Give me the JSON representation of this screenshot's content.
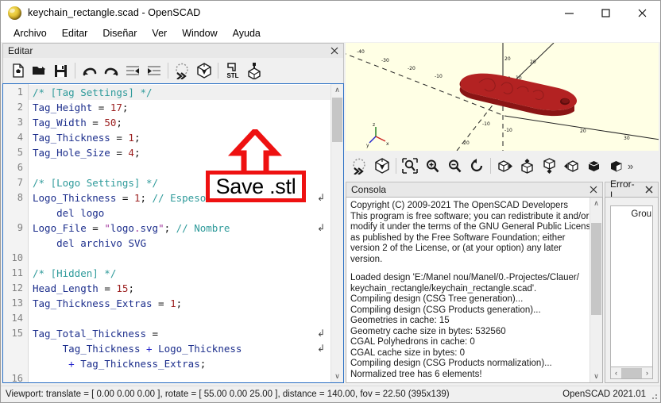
{
  "window": {
    "title": "keychain_rectangle.scad - OpenSCAD",
    "icon": "openscad-logo-icon",
    "minimize_label": "—",
    "maximize_label": "□",
    "close_label": "✕"
  },
  "menubar": {
    "items": [
      {
        "label": "Archivo",
        "name": "menu-archivo"
      },
      {
        "label": "Editar",
        "name": "menu-editar"
      },
      {
        "label": "Diseñar",
        "name": "menu-disenar"
      },
      {
        "label": "Ver",
        "name": "menu-ver"
      },
      {
        "label": "Window",
        "name": "menu-window"
      },
      {
        "label": "Ayuda",
        "name": "menu-ayuda"
      }
    ]
  },
  "editor_dock": {
    "title": "Editar",
    "close_label": "✕",
    "toolbar": [
      {
        "name": "new-file-button",
        "icon": "new-document-icon",
        "tooltip": "New"
      },
      {
        "name": "open-file-button",
        "icon": "open-folder-icon",
        "tooltip": "Open"
      },
      {
        "name": "save-file-button",
        "icon": "floppy-save-icon",
        "tooltip": "Save"
      },
      {
        "name": "undo-button",
        "icon": "undo-arrow-icon",
        "tooltip": "Undo"
      },
      {
        "name": "redo-button",
        "icon": "redo-arrow-icon",
        "tooltip": "Redo"
      },
      {
        "name": "unindent-button",
        "icon": "unindent-icon",
        "tooltip": "Unindent"
      },
      {
        "name": "indent-button",
        "icon": "indent-icon",
        "tooltip": "Indent"
      },
      {
        "name": "preview-button",
        "icon": "preview-sphere-icon",
        "tooltip": "Preview"
      },
      {
        "name": "render-button",
        "icon": "render-cube-icon",
        "tooltip": "Render"
      },
      {
        "name": "export-stl-button",
        "icon": "stl-export-icon",
        "tooltip": "Export as STL"
      },
      {
        "name": "export-amf-button",
        "icon": "amf-export-icon",
        "tooltip": "Export as AMF"
      }
    ]
  },
  "code": {
    "lines": [
      {
        "num": "1",
        "text": "/* [Tag Settings] */",
        "wrap": false
      },
      {
        "num": "2",
        "text": "Tag_Height = 17;",
        "wrap": false
      },
      {
        "num": "3",
        "text": "Tag_Width = 50;",
        "wrap": false
      },
      {
        "num": "4",
        "text": "Tag_Thickness = 1;",
        "wrap": false
      },
      {
        "num": "5",
        "text": "Tag_Hole_Size = 4;",
        "wrap": false
      },
      {
        "num": "6",
        "text": "",
        "wrap": false
      },
      {
        "num": "7",
        "text": "/* [Logo Settings] */",
        "wrap": false
      },
      {
        "num": "8",
        "text": "Logo_Thickness = 1; // Espesor",
        "wrap": true
      },
      {
        "num": "",
        "text": "    del logo",
        "wrap": false
      },
      {
        "num": "9",
        "text": "Logo_File = \"logo.svg\"; // Nombre",
        "wrap": true
      },
      {
        "num": "",
        "text": "    del archivo SVG",
        "wrap": false
      },
      {
        "num": "10",
        "text": "",
        "wrap": false
      },
      {
        "num": "11",
        "text": "/* [Hidden] */",
        "wrap": false
      },
      {
        "num": "12",
        "text": "Head_Length = 15;",
        "wrap": false
      },
      {
        "num": "13",
        "text": "Tag_Thickness_Extras = 1;",
        "wrap": false
      },
      {
        "num": "14",
        "text": "",
        "wrap": false
      },
      {
        "num": "15",
        "text": "Tag_Total_Thickness =",
        "wrap": true
      },
      {
        "num": "",
        "text": "     Tag_Thickness + Logo_Thickness",
        "wrap": true
      },
      {
        "num": "",
        "text": "      + Tag_Thickness_Extras;",
        "wrap": false
      },
      {
        "num": "16",
        "text": "",
        "wrap": false
      }
    ],
    "wrap_marker": "↲",
    "scroll_up": "∧",
    "scroll_down": "∨"
  },
  "annotation": {
    "label": "Save .stl",
    "color": "#ee1111",
    "arrow": "up-arrow-annotation"
  },
  "viewport": {
    "background_color": "#ffffe5",
    "model_color": "#b32222",
    "axis_label_x": "x",
    "axis_label_y": "y",
    "axis_label_z": "z",
    "toolbar": [
      {
        "name": "vp-preview-button",
        "icon": "preview-sphere-icon"
      },
      {
        "name": "vp-render-button",
        "icon": "render-cube-icon"
      },
      {
        "name": "vp-zoom-fit-button",
        "icon": "zoom-fit-icon"
      },
      {
        "name": "vp-zoom-in-button",
        "icon": "zoom-in-icon"
      },
      {
        "name": "vp-zoom-out-button",
        "icon": "zoom-out-icon"
      },
      {
        "name": "vp-reset-view-button",
        "icon": "reset-rotate-icon"
      },
      {
        "name": "vp-right-view-button",
        "icon": "cube-right-icon"
      },
      {
        "name": "vp-top-view-button",
        "icon": "cube-top-icon"
      },
      {
        "name": "vp-bottom-view-button",
        "icon": "cube-bottom-icon"
      },
      {
        "name": "vp-left-view-button",
        "icon": "cube-left-icon"
      },
      {
        "name": "vp-front-view-button",
        "icon": "cube-front-icon"
      },
      {
        "name": "vp-back-view-button",
        "icon": "cube-back-icon"
      },
      {
        "name": "vp-overflow-button",
        "icon": "chevron-double-right-icon",
        "label": "»"
      }
    ]
  },
  "console": {
    "title": "Consola",
    "close_label": "✕",
    "lines": [
      "Copyright (C) 2009-2021 The OpenSCAD Developers",
      "This program is free software; you can redistribute it and/or",
      "modify it under the terms of the GNU General Public License",
      "as published by the Free Software Foundation; either",
      "version 2 of the License, or (at your option) any later",
      "version.",
      "",
      "Loaded design 'E:/Manel nou/Manel/0.-Projectes/Clauer/",
      "keychain_rectangle/keychain_rectangle.scad'.",
      "Compiling design (CSG Tree generation)...",
      "Compiling design (CSG Products generation)...",
      "Geometries in cache: 15",
      "Geometry cache size in bytes: 532560",
      "CGAL Polyhedrons in cache: 0",
      "CGAL cache size in bytes: 0",
      "Compiling design (CSG Products normalization)...",
      "Normalized tree has 6 elements!"
    ],
    "scroll_up": "∧",
    "scroll_down": "∨"
  },
  "error_log": {
    "title": "Error-L...",
    "close_label": "✕",
    "column_header": "Grou",
    "scroll_left": "‹",
    "scroll_right": "›"
  },
  "statusbar": {
    "viewport_info": "Viewport: translate = [ 0.00 0.00 0.00 ], rotate = [ 55.00 0.00 25.00 ], distance = 140.00, fov = 22.50 (395x139)",
    "version": "OpenSCAD 2021.01"
  }
}
